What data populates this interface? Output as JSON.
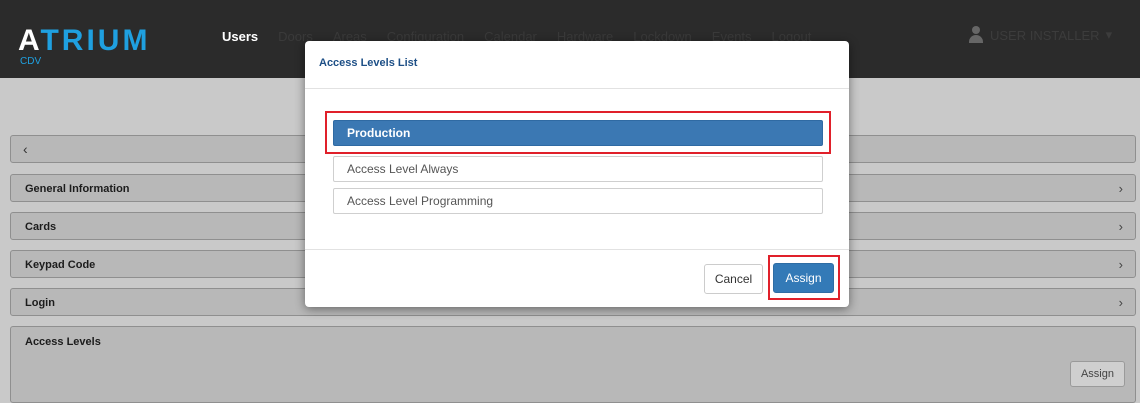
{
  "app": {
    "logo_text_prefix": "A",
    "logo_text_accent": "TRIUM",
    "logo_sub": "CDV"
  },
  "nav": {
    "items": [
      {
        "label": "Users",
        "active": true
      },
      {
        "label": "Doors",
        "active": false
      },
      {
        "label": "Areas",
        "active": false
      },
      {
        "label": "Configuration",
        "active": false
      },
      {
        "label": "Calendar",
        "active": false
      },
      {
        "label": "Hardware",
        "active": false
      },
      {
        "label": "Lockdown",
        "active": false
      },
      {
        "label": "Events",
        "active": false
      },
      {
        "label": "Logout",
        "active": false
      }
    ],
    "user_label": "USER INSTALLER"
  },
  "page": {
    "back_glyph": "‹",
    "sections": [
      {
        "label": "General Information"
      },
      {
        "label": "Cards"
      },
      {
        "label": "Keypad Code"
      },
      {
        "label": "Login"
      }
    ],
    "chevron_glyph": "›",
    "access_levels_label": "Access Levels",
    "access_levels_assign": "Assign"
  },
  "modal": {
    "title": "Access Levels List",
    "items": [
      {
        "label": "Production",
        "selected": true
      },
      {
        "label": "Access Level Always",
        "selected": false
      },
      {
        "label": "Access Level Programming",
        "selected": false
      }
    ],
    "cancel_label": "Cancel",
    "assign_label": "Assign"
  },
  "colors": {
    "navbar": "#2b2b2b",
    "accent": "#1fa0e0",
    "selected_item": "#3b78b3",
    "primary_button": "#337ab7",
    "highlight": "#e0202a"
  }
}
